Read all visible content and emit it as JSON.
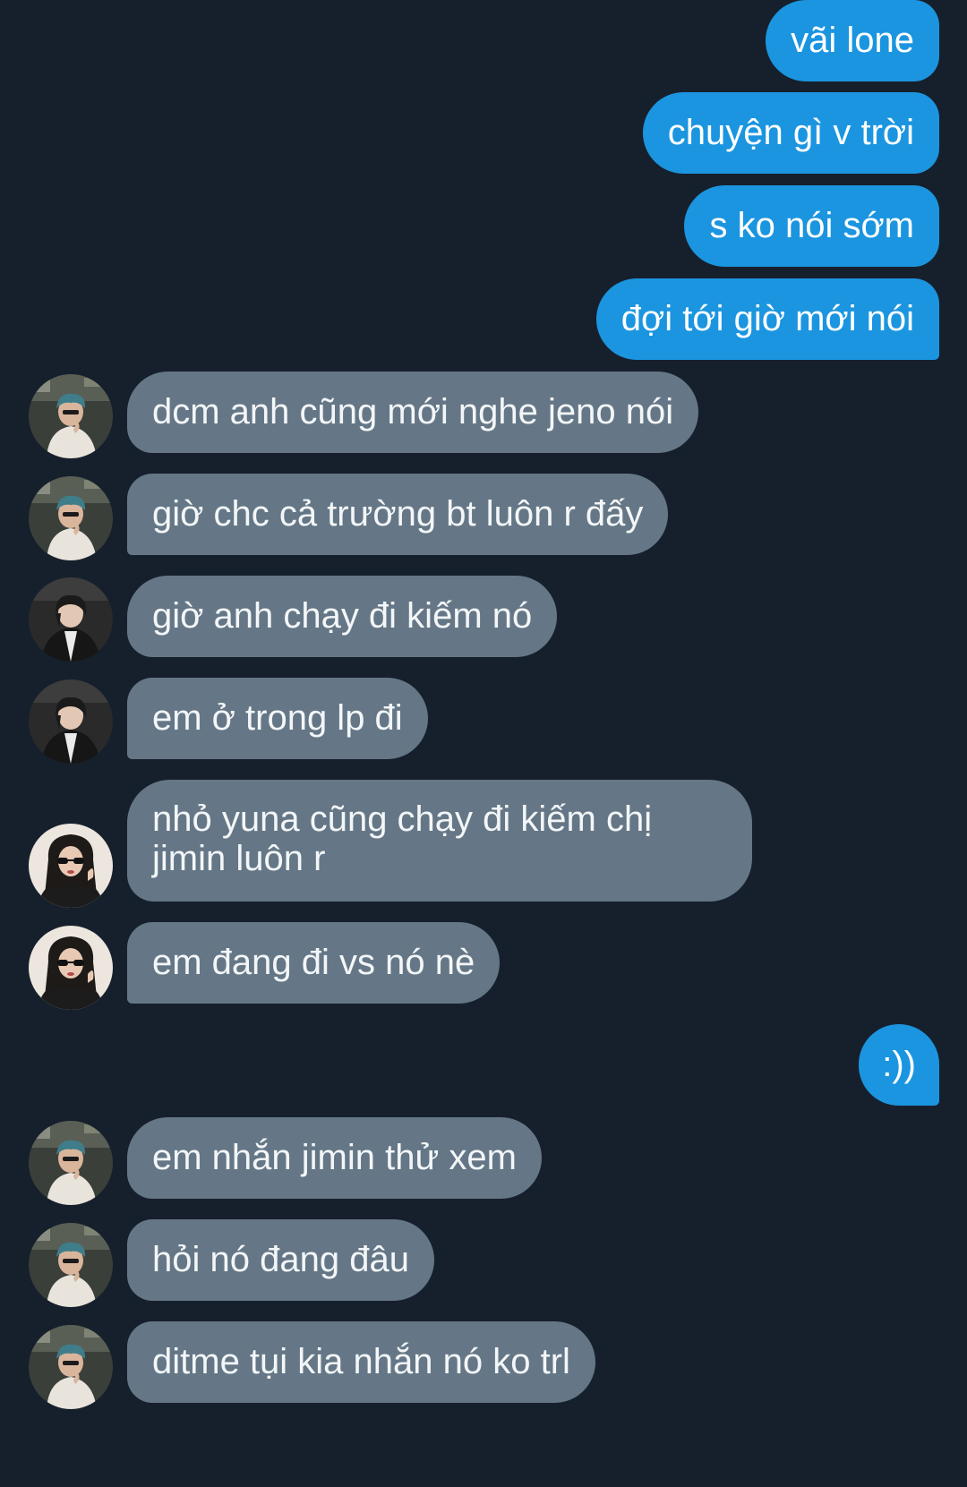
{
  "conversation": {
    "messages": [
      {
        "id": "m1",
        "side": "out",
        "text": "vãi lone"
      },
      {
        "id": "m2",
        "side": "out",
        "text": "chuyện gì v trời"
      },
      {
        "id": "m3",
        "side": "out",
        "text": "s ko nói sớm"
      },
      {
        "id": "m4",
        "side": "out",
        "text": "đợi tới giờ mới nói"
      },
      {
        "id": "m5",
        "side": "in",
        "avatar": "avatar-teal-hair-guy",
        "text": "dcm anh cũng mới nghe jeno nói"
      },
      {
        "id": "m6",
        "side": "in",
        "avatar": "avatar-teal-hair-guy",
        "text": "giờ chc cả trường bt luôn r đấy"
      },
      {
        "id": "m7",
        "side": "in",
        "avatar": "avatar-dark-hair-guy",
        "text": "giờ anh chạy đi kiếm nó"
      },
      {
        "id": "m8",
        "side": "in",
        "avatar": "avatar-dark-hair-guy",
        "text": "em ở trong lp đi"
      },
      {
        "id": "m9",
        "side": "in",
        "avatar": "avatar-girl-sunglasses",
        "text": "nhỏ yuna cũng chạy đi kiếm chị jimin luôn r"
      },
      {
        "id": "m10",
        "side": "in",
        "avatar": "avatar-girl-sunglasses",
        "text": "em đang đi vs nó nè"
      },
      {
        "id": "m11",
        "side": "out",
        "text": ":))"
      },
      {
        "id": "m12",
        "side": "in",
        "avatar": "avatar-teal-hair-guy",
        "text": "em nhắn jimin thử xem"
      },
      {
        "id": "m13",
        "side": "in",
        "avatar": "avatar-teal-hair-guy",
        "text": "hỏi nó đang đâu"
      },
      {
        "id": "m14",
        "side": "in",
        "avatar": "avatar-teal-hair-guy",
        "text": "ditme tụi kia nhắn nó ko trl"
      }
    ]
  },
  "colors": {
    "background": "#16202c",
    "outgoing_bubble": "#1b95e0",
    "incoming_bubble": "#657786",
    "text": "#f3f6f8"
  }
}
